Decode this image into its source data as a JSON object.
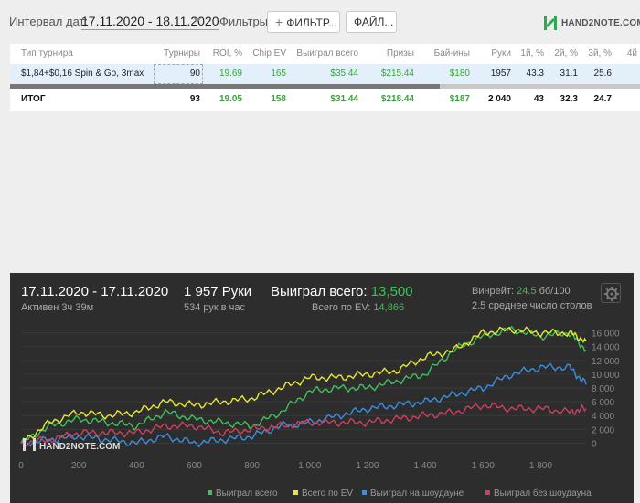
{
  "topbar": {
    "date_label": "Интервал дат:",
    "date_range": "17.11.2020 - 18.11.2020",
    "filters_label": "Фильтры:",
    "filter_button": "ФИЛЬТР...",
    "file_button": "ФАЙЛ...",
    "logo_text": "HAND2NOTE.COM"
  },
  "table": {
    "headers": [
      "Тип турнира",
      "Турниры",
      "ROI, %",
      "Chip EV",
      "Выиграл всего",
      "Призы",
      "Бай-ины",
      "Руки",
      "1й, %",
      "2й, %",
      "3й, %",
      "4й"
    ],
    "row": [
      "$1,84+$0,16 Spin & Go, 3max",
      "90",
      "19.69",
      "165",
      "$35.44",
      "$215.44",
      "$180",
      "1957",
      "43.3",
      "31.1",
      "25.6",
      ""
    ],
    "total": [
      "ИТОГ",
      "93",
      "19.05",
      "158",
      "$31.44",
      "$218.44",
      "$187",
      "2 040",
      "43",
      "32.3",
      "24.7",
      ""
    ]
  },
  "panel": {
    "date_range": "17.11.2020 - 17.11.2020",
    "active": "Активен 3ч 39м",
    "hands": "1 957 Руки",
    "hands_rate": "534 рук в час",
    "won_label": "Выиграл всего:",
    "won_value": "13,500",
    "ev_label": "Всего по EV:",
    "ev_value": "14,866",
    "winrate_label": "Винрейт:",
    "winrate_value": "24.5",
    "winrate_unit": "бб/100",
    "tables_avg": "2.5 среднее число столов",
    "watermark": "HAND2NOTE.COM"
  },
  "colors": {
    "green": "#3fc05a",
    "yellow": "#e8e830",
    "blue": "#3b8fe0",
    "pink": "#d0405e",
    "panel_bg": "#2d2d2d"
  },
  "chart_data": {
    "type": "line",
    "title": "",
    "xlabel": "",
    "ylabel": "",
    "xlim": [
      0,
      1957
    ],
    "ylim": [
      -1000,
      17000
    ],
    "x_ticks": [
      "0",
      "200",
      "400",
      "600",
      "800",
      "1 000",
      "1 200",
      "1 400",
      "1 600",
      "1 800"
    ],
    "y_ticks": [
      "0",
      "2 000",
      "4 000",
      "6 000",
      "8 000",
      "10 000",
      "12 000",
      "14 000",
      "16 000"
    ],
    "legend": [
      "Выиграл всего",
      "Всего по EV",
      "Выиграл на шоудауне",
      "Выиграл без шоудауна"
    ],
    "legend_position": "bottom",
    "x": [
      0,
      100,
      200,
      300,
      400,
      500,
      600,
      700,
      800,
      900,
      1000,
      1100,
      1200,
      1300,
      1400,
      1500,
      1600,
      1700,
      1800,
      1900,
      1957
    ],
    "series": [
      {
        "name": "Выиграл всего",
        "color": "#3fc05a",
        "values": [
          0,
          2500,
          3500,
          3000,
          2500,
          4500,
          3500,
          3000,
          2500,
          4500,
          7500,
          8000,
          8000,
          9000,
          10000,
          13500,
          15500,
          16500,
          15500,
          16000,
          13500
        ]
      },
      {
        "name": "Всего по EV",
        "color": "#e8e830",
        "values": [
          0,
          3000,
          4500,
          4000,
          4500,
          6000,
          5500,
          6000,
          6500,
          8000,
          9500,
          9500,
          10000,
          10500,
          12500,
          13500,
          16000,
          16500,
          16000,
          16000,
          14800
        ]
      },
      {
        "name": "Выиграл на шоудауне",
        "color": "#3b8fe0",
        "values": [
          0,
          500,
          1000,
          500,
          0,
          1000,
          0,
          500,
          1000,
          2500,
          3000,
          4000,
          5000,
          5500,
          6000,
          7000,
          8000,
          10000,
          11000,
          11000,
          8500
        ]
      },
      {
        "name": "Выиграл без шоудауна",
        "color": "#d0405e",
        "values": [
          0,
          500,
          1500,
          1500,
          1500,
          2500,
          2500,
          1500,
          2000,
          2500,
          3000,
          3000,
          3000,
          3500,
          4000,
          4500,
          5500,
          5000,
          5000,
          4500,
          5000
        ]
      }
    ]
  }
}
